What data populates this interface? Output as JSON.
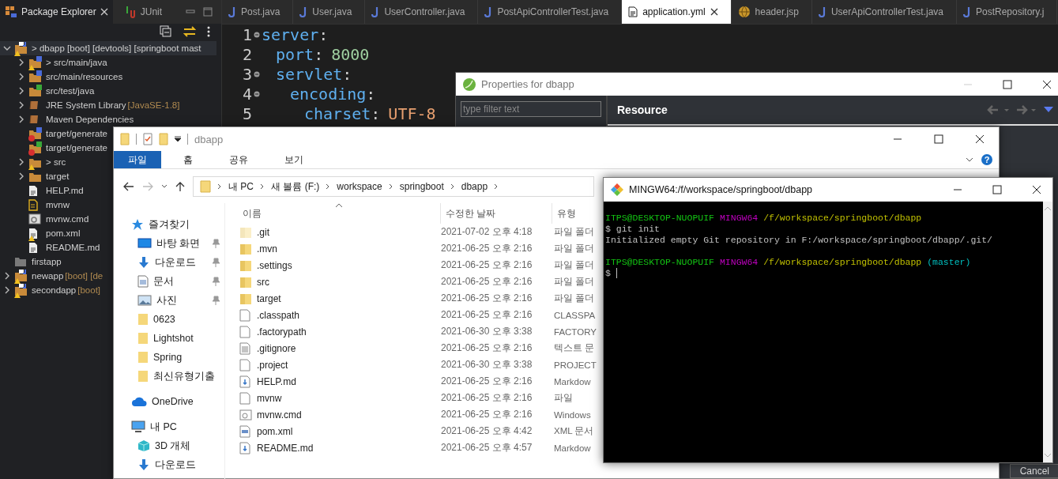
{
  "eclipse": {
    "package_explorer": {
      "tabs": [
        {
          "label": "Package Explorer",
          "selected": true
        },
        {
          "label": "JUnit",
          "selected": false
        }
      ],
      "tree": [
        {
          "kind": "project",
          "label": "> dbapp [boot] [devtools] [springboot mast",
          "warning": true,
          "error": false,
          "selected": true,
          "expanded": true,
          "children": [
            {
              "kind": "source-folder",
              "label": "> src/main/java",
              "warning": true,
              "error": false,
              "selected": false,
              "expanded": false
            },
            {
              "kind": "source-folder",
              "label": "src/main/resources",
              "warning": false,
              "error": false,
              "selected": false,
              "expanded": false
            },
            {
              "kind": "test-folder",
              "label": "src/test/java",
              "warning": false,
              "error": false,
              "selected": false,
              "expanded": false
            },
            {
              "kind": "library",
              "label": "JRE System Library",
              "decoration": "[JavaSE-1.8]",
              "warning": false,
              "error": false,
              "selected": false,
              "expanded": false
            },
            {
              "kind": "library",
              "label": "Maven Dependencies",
              "warning": false,
              "error": false,
              "selected": false,
              "expanded": false
            },
            {
              "kind": "source-folder",
              "label": "target/generate",
              "warning": false,
              "error": true,
              "selected": false
            },
            {
              "kind": "test-folder",
              "label": "target/generate",
              "warning": false,
              "error": true,
              "selected": false
            },
            {
              "kind": "folder",
              "label": "> src",
              "warning": true,
              "error": false,
              "selected": false,
              "expanded": false
            },
            {
              "kind": "folder",
              "label": "target",
              "warning": false,
              "error": false,
              "selected": false,
              "expanded": false
            },
            {
              "kind": "file",
              "label": "HELP.md",
              "warning": false,
              "error": false,
              "selected": false
            },
            {
              "kind": "script",
              "label": "mvnw",
              "warning": false,
              "error": false,
              "selected": false
            },
            {
              "kind": "cmd",
              "label": "mvnw.cmd",
              "warning": false,
              "error": false,
              "selected": false
            },
            {
              "kind": "file",
              "label": "pom.xml",
              "warning": true,
              "error": false,
              "selected": false
            },
            {
              "kind": "file",
              "label": "README.md",
              "warning": false,
              "error": false,
              "selected": false
            }
          ]
        },
        {
          "kind": "closed-project",
          "label": "firstapp",
          "warning": false,
          "error": false,
          "selected": false
        },
        {
          "kind": "project",
          "label": "newapp",
          "decoration": "[boot] [de",
          "warning": true,
          "error": false,
          "selected": false,
          "expanded": false
        },
        {
          "kind": "project",
          "label": "secondapp",
          "decoration": "[boot]",
          "warning": true,
          "error": false,
          "selected": false,
          "expanded": false
        }
      ]
    },
    "editor_tabs": [
      {
        "label": "Post.java",
        "kind": "java",
        "selected": false
      },
      {
        "label": "User.java",
        "kind": "java",
        "selected": false
      },
      {
        "label": "UserController.java",
        "kind": "java",
        "selected": false
      },
      {
        "label": "PostApiControllerTest.java",
        "kind": "java",
        "selected": false
      },
      {
        "label": "application.yml",
        "kind": "yml",
        "selected": true
      },
      {
        "label": "header.jsp",
        "kind": "jsp",
        "selected": false
      },
      {
        "label": "UserApiControllerTest.java",
        "kind": "java",
        "selected": false
      },
      {
        "label": "PostRepository.j",
        "kind": "java",
        "selected": false
      }
    ],
    "code": [
      {
        "line": "1",
        "key": "server",
        "colon": ":",
        "children": [
          {
            "line": "2",
            "key": "port",
            "colon": ":",
            "value": "8000",
            "kind": "number"
          },
          {
            "line": "3",
            "key": "servlet",
            "colon": ":",
            "children": [
              {
                "line": "4",
                "key": "encoding",
                "colon": ":",
                "children": [
                  {
                    "line": "5",
                    "key": "charset",
                    "colon": ":",
                    "value": "UTF-8",
                    "kind": "string"
                  }
                ]
              }
            ]
          }
        ]
      }
    ]
  },
  "properties_window": {
    "title": "Properties for dbapp",
    "filter": {
      "placeholder": "type filter text"
    },
    "page_title": "Resource",
    "cancel_button": "Cancel"
  },
  "file_explorer": {
    "title": "dbapp",
    "ribbon_tabs": [
      {
        "label": "파일",
        "selected": true
      },
      {
        "label": "홈",
        "selected": false
      },
      {
        "label": "공유",
        "selected": false
      },
      {
        "label": "보기",
        "selected": false
      }
    ],
    "help": "?",
    "breadcrumbs": [
      "내 PC",
      "새 볼륨 (F:)",
      "workspace",
      "springboot",
      "dbapp"
    ],
    "nav": [
      {
        "label": "즐겨찾기",
        "kind": "star",
        "children": [
          {
            "label": "바탕 화면",
            "kind": "desktop",
            "pinned": true
          },
          {
            "label": "다운로드",
            "kind": "download",
            "pinned": true
          },
          {
            "label": "문서",
            "kind": "document",
            "pinned": true
          },
          {
            "label": "사진",
            "kind": "picture",
            "pinned": true
          },
          {
            "label": "0623",
            "kind": "folder",
            "pinned": false
          },
          {
            "label": "Lightshot",
            "kind": "folder",
            "pinned": false
          },
          {
            "label": "Spring",
            "kind": "folder",
            "pinned": false
          },
          {
            "label": "최신유형기출",
            "kind": "folder",
            "pinned": false
          }
        ]
      },
      {
        "label": "OneDrive",
        "kind": "cloud"
      },
      {
        "label": "내 PC",
        "kind": "pc",
        "children": [
          {
            "label": "3D 개체",
            "kind": "cube"
          },
          {
            "label": "다운로드",
            "kind": "download"
          }
        ]
      }
    ],
    "columns": [
      "이름",
      "수정한 날짜",
      "유형"
    ],
    "files": [
      {
        "name": ".git",
        "kind": "hidden-folder",
        "date": "2021-07-02 오후 4:18",
        "type": "파일 폴더"
      },
      {
        "name": ".mvn",
        "kind": "folder",
        "date": "2021-06-25 오후 2:16",
        "type": "파일 폴더"
      },
      {
        "name": ".settings",
        "kind": "folder",
        "date": "2021-06-25 오후 2:16",
        "type": "파일 폴더"
      },
      {
        "name": "src",
        "kind": "folder",
        "date": "2021-06-25 오후 2:16",
        "type": "파일 폴더"
      },
      {
        "name": "target",
        "kind": "folder",
        "date": "2021-06-25 오후 2:16",
        "type": "파일 폴더"
      },
      {
        "name": ".classpath",
        "kind": "file",
        "date": "2021-06-25 오후 2:16",
        "type": "CLASSPA"
      },
      {
        "name": ".factorypath",
        "kind": "file",
        "date": "2021-06-30 오후 3:38",
        "type": "FACTORY"
      },
      {
        "name": ".gitignore",
        "kind": "text",
        "date": "2021-06-25 오후 2:16",
        "type": "텍스트 문"
      },
      {
        "name": ".project",
        "kind": "file",
        "date": "2021-06-30 오후 3:38",
        "type": "PROJECT"
      },
      {
        "name": "HELP.md",
        "kind": "markdown",
        "date": "2021-06-25 오후 2:16",
        "type": "Markdow"
      },
      {
        "name": "mvnw",
        "kind": "file",
        "date": "2021-06-25 오후 2:16",
        "type": "파일"
      },
      {
        "name": "mvnw.cmd",
        "kind": "cmd",
        "date": "2021-06-25 오후 2:16",
        "type": "Windows"
      },
      {
        "name": "pom.xml",
        "kind": "xml",
        "date": "2021-06-25 오후 4:42",
        "type": "XML 문서"
      },
      {
        "name": "README.md",
        "kind": "markdown",
        "date": "2021-06-25 오후 4:57",
        "type": "Markdow"
      }
    ]
  },
  "terminal": {
    "title": "MINGW64:/f/workspace/springboot/dbapp",
    "lines": [
      {
        "kind": "text",
        "segments": [
          {
            "text": "ITPS@DESKTOP-NUOPUIF",
            "color": "#13c313"
          },
          {
            "text": "MINGW64",
            "color": "#c000c0"
          },
          {
            "text": "/f/workspace/springboot/dbapp",
            "color": "#c0c000"
          }
        ]
      },
      {
        "kind": "text",
        "segments": [
          {
            "text": "$ git init",
            "color": "#c0c0c0"
          }
        ]
      },
      {
        "kind": "text",
        "segments": [
          {
            "text": "Initialized empty Git repository in F:/workspace/springboot/dbapp/.git/",
            "color": "#c0c0c0"
          }
        ]
      },
      {
        "kind": "blank"
      },
      {
        "kind": "text",
        "segments": [
          {
            "text": "ITPS@DESKTOP-NUOPUIF",
            "color": "#13c313"
          },
          {
            "text": "MINGW64",
            "color": "#c000c0"
          },
          {
            "text": "/f/workspace/springboot/dbapp",
            "color": "#c0c000"
          },
          {
            "text": "(master)",
            "color": "#00bfbf"
          }
        ]
      },
      {
        "kind": "input",
        "segments": [
          {
            "text": "$",
            "color": "#c0c0c0"
          }
        ]
      }
    ]
  }
}
